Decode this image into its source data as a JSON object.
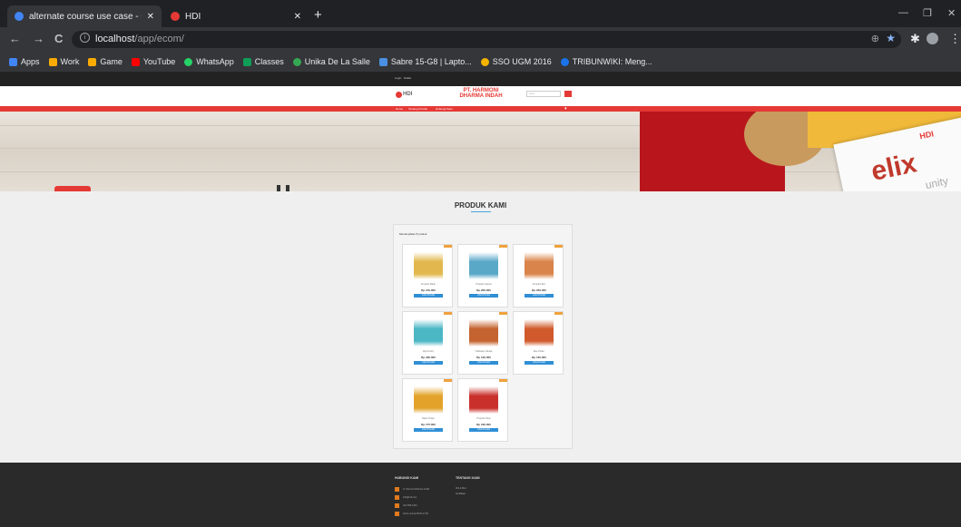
{
  "browser": {
    "tabs": [
      {
        "title": "alternate course use case - Goog",
        "favicon_color": "#4285f4",
        "active": true
      },
      {
        "title": "HDI",
        "favicon_color": "#e53935",
        "active": false
      }
    ],
    "new_tab": "+",
    "window_controls": {
      "minimize": "—",
      "maximize": "❐",
      "close": "✕"
    },
    "nav": {
      "back": "←",
      "forward": "→",
      "reload": "C"
    },
    "url": {
      "host": "localhost",
      "path": "/app/ecom/"
    },
    "toolbar_icons": {
      "zoom": "⊕",
      "star": "★",
      "extensions": "✱",
      "menu": "⋮"
    },
    "bookmarks": [
      {
        "label": "Apps",
        "color": "#4285f4"
      },
      {
        "label": "Work",
        "color": "#f9ab00"
      },
      {
        "label": "Game",
        "color": "#f9ab00"
      },
      {
        "label": "YouTube",
        "color": "#ff0000"
      },
      {
        "label": "WhatsApp",
        "color": "#25d366"
      },
      {
        "label": "Classes",
        "color": "#0f9d58"
      },
      {
        "label": "Unika De La Salle",
        "color": "#34a853"
      },
      {
        "label": "Sabre 15-G8 | Lapto...",
        "color": "#4a90e2"
      },
      {
        "label": "SSO UGM 2016",
        "color": "#f4b400"
      },
      {
        "label": "TRIBUNWIKI: Meng...",
        "color": "#1a73e8"
      }
    ]
  },
  "site": {
    "top_links": [
      "Login",
      "Daftar"
    ],
    "logo": "HDI",
    "brand_line1": "PT. HARMONI",
    "brand_line2": "DHARMA INDAH",
    "search_placeholder": "Cari",
    "menu": [
      "Home",
      "Tentang Produk",
      "Hubungi Kami"
    ],
    "hero_text": "elix",
    "hero_sub": "unity",
    "section_title": "PRODUK KAMI",
    "panel_caption": "Menampilkan 8 produk",
    "products": [
      {
        "name": "Propolis Madu",
        "price": "Rp 150.000",
        "button": "Lihat Produk",
        "color": "#e2b84e"
      },
      {
        "name": "Propolis Kapsul",
        "price": "Rp 200.000",
        "button": "Lihat Produk",
        "color": "#5aa8c8"
      },
      {
        "name": "Propolis Box",
        "price": "Rp 250.000",
        "button": "Lihat Produk",
        "color": "#d9844a"
      },
      {
        "name": "Royal Jelly",
        "price": "Rp 180.000",
        "button": "Lihat Produk",
        "color": "#4bb6c4"
      },
      {
        "name": "Habbatus Sauda",
        "price": "Rp 120.000",
        "button": "Lihat Produk",
        "color": "#c4632f"
      },
      {
        "name": "Bee Pollen",
        "price": "Rp 130.000",
        "button": "Lihat Produk",
        "color": "#d05a2c"
      },
      {
        "name": "Madu Hutan",
        "price": "Rp 175.000",
        "button": "Lihat Produk",
        "color": "#e3a32a"
      },
      {
        "name": "Propolis Pack",
        "price": "Rp 160.000",
        "button": "Lihat Produk",
        "color": "#c9302c"
      }
    ],
    "footer": {
      "contact_title": "HUBUNGI KAMI",
      "contact_items": [
        "Jl. Harmoni Dharma Indah",
        "info@hdi.com",
        "021-555-1234",
        "Senin-Jumat 08:00-17:00"
      ],
      "about_title": "TENTANG KAMI",
      "about_items": [
        "Visi & Misi",
        "Sertifikasi"
      ]
    }
  }
}
